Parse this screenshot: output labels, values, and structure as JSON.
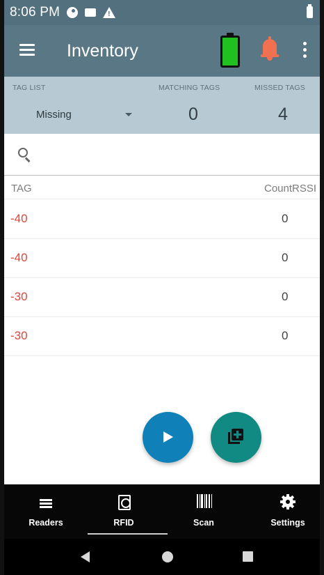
{
  "status_bar": {
    "time": "8:06 PM",
    "icons": [
      "notification-circle-icon",
      "message-icon",
      "warning-icon",
      "battery-icon"
    ]
  },
  "app_bar": {
    "title": "Inventory",
    "icons": [
      "menu-icon",
      "reader-battery-icon",
      "bell-icon",
      "more-vert-icon"
    ],
    "colors": {
      "battery_fill": "#21c021",
      "bell": "#f07050"
    }
  },
  "summary": {
    "tag_list_label": "TAG LIST",
    "tag_list_selected": "Missing",
    "matching_label": "MATCHING TAGS",
    "matching_value": "0",
    "missed_label": "MISSED TAGS",
    "missed_value": "4"
  },
  "search": {
    "placeholder": ""
  },
  "table": {
    "headers": {
      "tag": "TAG",
      "count": "Count",
      "rssi": "RSSI"
    },
    "rows": [
      {
        "rssi": "-40",
        "count": "0"
      },
      {
        "rssi": "-40",
        "count": "0"
      },
      {
        "rssi": "-30",
        "count": "0"
      },
      {
        "rssi": "-30",
        "count": "0"
      }
    ],
    "colors": {
      "rssi_text": "#e0443e"
    }
  },
  "fabs": {
    "play": "play-icon",
    "add": "add-to-queue-icon"
  },
  "bottom_nav": {
    "items": [
      {
        "label": "Readers",
        "icon": "list-icon"
      },
      {
        "label": "RFID",
        "icon": "rfid-icon"
      },
      {
        "label": "Scan",
        "icon": "barcode-icon"
      },
      {
        "label": "Settings",
        "icon": "gear-icon"
      }
    ],
    "active": "RFID"
  },
  "colors": {
    "status_bar": "#53707f",
    "app_bar": "#5a7786",
    "summary_bg": "#b7cad4",
    "fab_play": "#0f80b8",
    "fab_add": "#108a82",
    "nav_bg": "#070707"
  }
}
